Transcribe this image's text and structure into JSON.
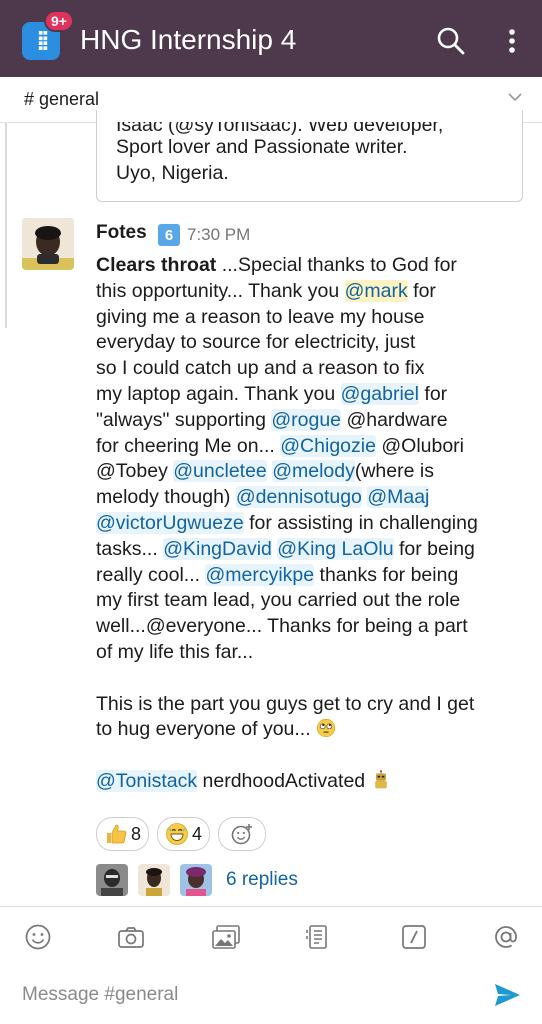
{
  "app": {
    "title": "HNG Internship 4",
    "badge": "9+",
    "icon": "workspace-logo-icon"
  },
  "channel": {
    "name": "# general"
  },
  "attachment": {
    "lines": [
      "Isaac (@syTonisaac). Web developer,",
      "Sport lover and Passionate writer.",
      "Uyo, Nigeria."
    ]
  },
  "message": {
    "author": "Fotes",
    "author_badge": "6",
    "time": "7:30 PM",
    "bold_lead": "Clears throat",
    "lines": [
      [
        [
          "t",
          " ...Special thanks to God for"
        ]
      ],
      [
        [
          "t",
          "this opportunity... Thank you "
        ],
        [
          "ms",
          "@mark"
        ],
        [
          "t",
          " for"
        ]
      ],
      [
        [
          "t",
          "giving me a reason to leave my house"
        ]
      ],
      [
        [
          "t",
          "everyday to source for electricity, just"
        ]
      ],
      [
        [
          "t",
          "so I could catch up and a reason to fix"
        ]
      ],
      [
        [
          "t",
          "my laptop again. Thank you "
        ],
        [
          "m",
          "@gabriel"
        ],
        [
          "t",
          " for"
        ]
      ],
      [
        [
          "t",
          "\"always\" supporting "
        ],
        [
          "m",
          "@rogue"
        ],
        [
          "t",
          " @hardware"
        ]
      ],
      [
        [
          "t",
          "for cheering Me on... "
        ],
        [
          "m",
          "@Chigozie"
        ],
        [
          "t",
          " @Olubori"
        ]
      ],
      [
        [
          "t",
          "@Tobey "
        ],
        [
          "m",
          "@uncletee"
        ],
        [
          "t",
          " "
        ],
        [
          "m",
          "@melody"
        ],
        [
          "t",
          "(where is"
        ]
      ],
      [
        [
          "t",
          "melody though) "
        ],
        [
          "m",
          "@dennisotugo"
        ],
        [
          "t",
          " "
        ],
        [
          "m",
          "@Maaj"
        ]
      ],
      [
        [
          "m",
          "@victorUgwueze"
        ],
        [
          "t",
          " for assisting in challenging"
        ]
      ],
      [
        [
          "t",
          "tasks... "
        ],
        [
          "m",
          "@KingDavid"
        ],
        [
          "t",
          " "
        ],
        [
          "m",
          "@King LaOlu"
        ],
        [
          "t",
          " for being"
        ]
      ],
      [
        [
          "t",
          "really cool... "
        ],
        [
          "m",
          "@mercyikpe"
        ],
        [
          "t",
          " thanks for being"
        ]
      ],
      [
        [
          "t",
          "my first team lead, you carried out the role"
        ]
      ],
      [
        [
          "t",
          "well...@everyone... Thanks for being a part"
        ]
      ],
      [
        [
          "t",
          "of my life this far..."
        ]
      ],
      [],
      [
        [
          "t",
          "This is the part you guys get to cry and I get"
        ]
      ],
      [
        [
          "t",
          "to hug everyone of you... "
        ],
        [
          "e",
          "face-rolling-eyes-emoji"
        ]
      ],
      [],
      [
        [
          "m",
          "@Tonistack"
        ],
        [
          "t",
          " nerdhoodActivated "
        ],
        [
          "e",
          "robot-emoji"
        ]
      ]
    ]
  },
  "reactions": [
    {
      "icon": "thumbs-up-emoji",
      "count": "8"
    },
    {
      "icon": "grinning-face-emoji",
      "count": "4"
    },
    {
      "icon": "add-reaction-icon",
      "count": ""
    }
  ],
  "replies": {
    "label": "6 replies",
    "avatars": [
      "reply-avatar-1",
      "reply-avatar-2",
      "reply-avatar-3"
    ]
  },
  "toolbar": {
    "tools": [
      "emoji-icon",
      "camera-icon",
      "gallery-icon",
      "file-icon",
      "slash-command-icon",
      "mention-icon"
    ]
  },
  "composer": {
    "placeholder": "Message #general",
    "value": "",
    "send_icon": "send-icon"
  },
  "colors": {
    "app_bar": "#4d394b",
    "link": "#1264a3",
    "badge": "#e0325d",
    "send": "#1d9bd1"
  }
}
